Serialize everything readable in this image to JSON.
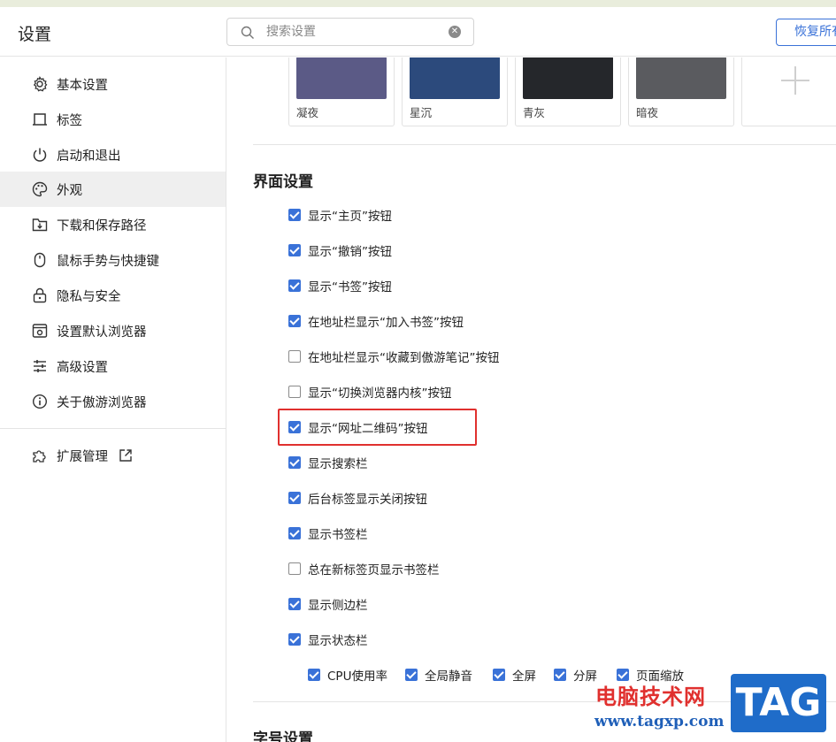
{
  "header": {
    "title": "设置",
    "search_placeholder": "搜索设置",
    "restore_label": "恢复所有"
  },
  "sidebar": {
    "items": [
      {
        "label": "基本设置",
        "icon": "gear-icon"
      },
      {
        "label": "标签",
        "icon": "tab-icon"
      },
      {
        "label": "启动和退出",
        "icon": "power-icon"
      },
      {
        "label": "外观",
        "icon": "palette-icon",
        "active": true
      },
      {
        "label": "下载和保存路径",
        "icon": "download-folder-icon"
      },
      {
        "label": "鼠标手势与快捷键",
        "icon": "mouse-icon"
      },
      {
        "label": "隐私与安全",
        "icon": "lock-icon"
      },
      {
        "label": "设置默认浏览器",
        "icon": "browser-icon"
      },
      {
        "label": "高级设置",
        "icon": "sliders-icon"
      },
      {
        "label": "关于傲游浏览器",
        "icon": "info-icon"
      }
    ],
    "extension": {
      "label": "扩展管理",
      "icon": "puzzle-icon"
    }
  },
  "themes": [
    {
      "name": "凝夜",
      "color": "#5b5a86"
    },
    {
      "name": "星沉",
      "color": "#2c4a7c"
    },
    {
      "name": "青灰",
      "color": "#25272b"
    },
    {
      "name": "暗夜",
      "color": "#5a5b5f"
    }
  ],
  "interface": {
    "title": "界面设置",
    "options": [
      {
        "label": "显示“主页”按钮",
        "checked": true
      },
      {
        "label": "显示“撤销”按钮",
        "checked": true
      },
      {
        "label": "显示“书签”按钮",
        "checked": true
      },
      {
        "label": "在地址栏显示“加入书签”按钮",
        "checked": true
      },
      {
        "label": "在地址栏显示“收藏到傲游笔记”按钮",
        "checked": false
      },
      {
        "label": "显示“切换浏览器内核”按钮",
        "checked": false
      },
      {
        "label": "显示“网址二维码”按钮",
        "checked": true
      },
      {
        "label": "显示搜索栏",
        "checked": true
      },
      {
        "label": "后台标签显示关闭按钮",
        "checked": true
      },
      {
        "label": "显示书签栏",
        "checked": true
      },
      {
        "label": "总在新标签页显示书签栏",
        "checked": false
      },
      {
        "label": "显示侧边栏",
        "checked": true
      },
      {
        "label": "显示状态栏",
        "checked": true
      }
    ],
    "status_bar_options": [
      {
        "label": "CPU使用率",
        "checked": true
      },
      {
        "label": "全局静音",
        "checked": true
      },
      {
        "label": "全屏",
        "checked": true
      },
      {
        "label": "分屏",
        "checked": true
      },
      {
        "label": "页面缩放",
        "checked": true
      }
    ]
  },
  "font_section": {
    "title": "字号设置"
  },
  "watermark": {
    "site_name": "电脑技术网",
    "url": "www.tagxp.com",
    "logo_text": "TAG"
  },
  "colors": {
    "accent": "#3a72d8",
    "highlight": "#e0302e",
    "active_bg": "#efefef"
  }
}
